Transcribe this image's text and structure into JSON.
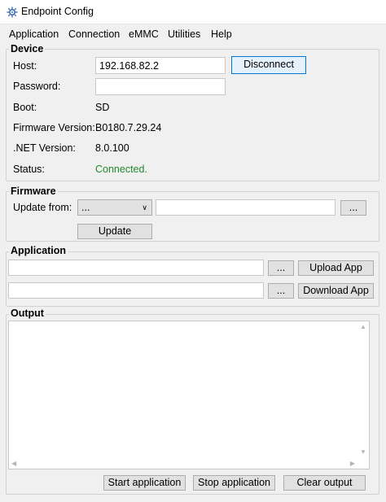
{
  "window": {
    "title": "Endpoint Config",
    "app_icon": "gear-network-icon"
  },
  "menu": [
    "Application",
    "Connection",
    "eMMC",
    "Utilities",
    "Help"
  ],
  "device": {
    "title": "Device",
    "host_label": "Host:",
    "host_value": "192.168.82.2",
    "disconnect_label": "Disconnect",
    "password_label": "Password:",
    "password_value": "",
    "boot_label": "Boot:",
    "boot_value": "SD",
    "firmware_version_label": "Firmware Version:",
    "firmware_version_value": "B0180.7.29.24",
    "net_version_label": ".NET Version:",
    "net_version_value": "8.0.100",
    "status_label": "Status:",
    "status_value": "Connected.",
    "status_color": "#1f8a2b"
  },
  "firmware": {
    "title": "Firmware",
    "update_from_label": "Update from:",
    "source_selected": "...",
    "path_value": "",
    "browse_label": "...",
    "update_label": "Update"
  },
  "application": {
    "title": "Application",
    "upload_path": "",
    "upload_browse_label": "...",
    "upload_label": "Upload App",
    "download_path": "",
    "download_browse_label": "...",
    "download_label": "Download App"
  },
  "output": {
    "title": "Output",
    "text": "",
    "start_label": "Start application",
    "stop_label": "Stop application",
    "clear_label": "Clear output"
  }
}
